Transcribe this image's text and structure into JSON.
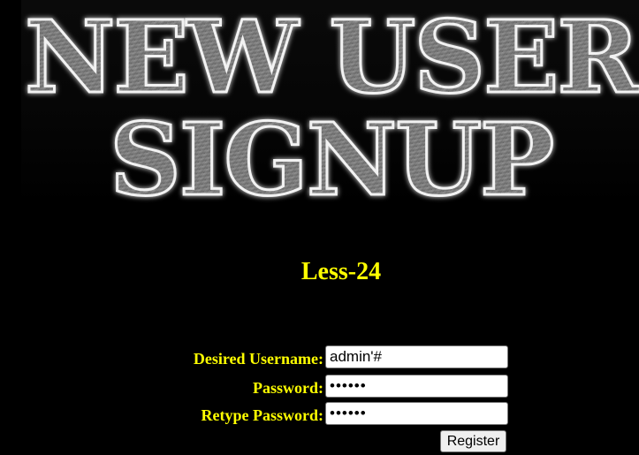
{
  "banner": {
    "line1": "NEW USER",
    "line2": "SIGNUP"
  },
  "lesson": {
    "title": "Less-24"
  },
  "form": {
    "username_label": "Desired Username:",
    "username_value": "admin'#",
    "password_label": "Password:",
    "password_value": "123456",
    "retype_label": "Retype Password:",
    "retype_value": "123456",
    "register_label": "Register"
  },
  "colors": {
    "background": "#000000",
    "accent_text": "#ffff00"
  }
}
